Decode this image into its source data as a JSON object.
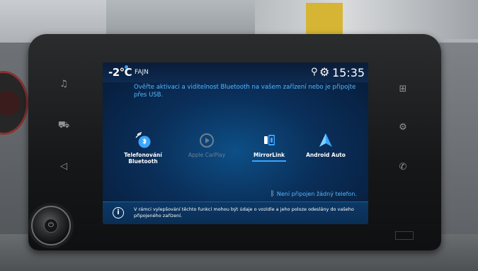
{
  "status": {
    "temperature": "-2°C",
    "weather": "FAJN",
    "time": "15:35"
  },
  "message": "Ověřte aktivaci a viditelnost Bluetooth na vašem zařízení nebo je připojte přes USB.",
  "options": [
    {
      "label": "Telefonování Bluetooth",
      "icon": "bluetooth-phone-icon",
      "enabled": true,
      "active": false
    },
    {
      "label": "Apple CarPlay",
      "icon": "carplay-icon",
      "enabled": false,
      "active": false
    },
    {
      "label": "MirrorLink",
      "icon": "mirrorlink-icon",
      "enabled": true,
      "active": true
    },
    {
      "label": "Android Auto",
      "icon": "android-auto-icon",
      "enabled": true,
      "active": false
    }
  ],
  "bluetooth_status": "Není připojen žádný telefon.",
  "info": "V rámci vylepšování těchto funkcí mohou být údaje o vozidle a jeho poloze odeslány do vašeho připojeného zařízení.",
  "colors": {
    "accent": "#3aa6ff",
    "screen_bg": "#0a2f5a",
    "message_text": "#55b8ff"
  }
}
